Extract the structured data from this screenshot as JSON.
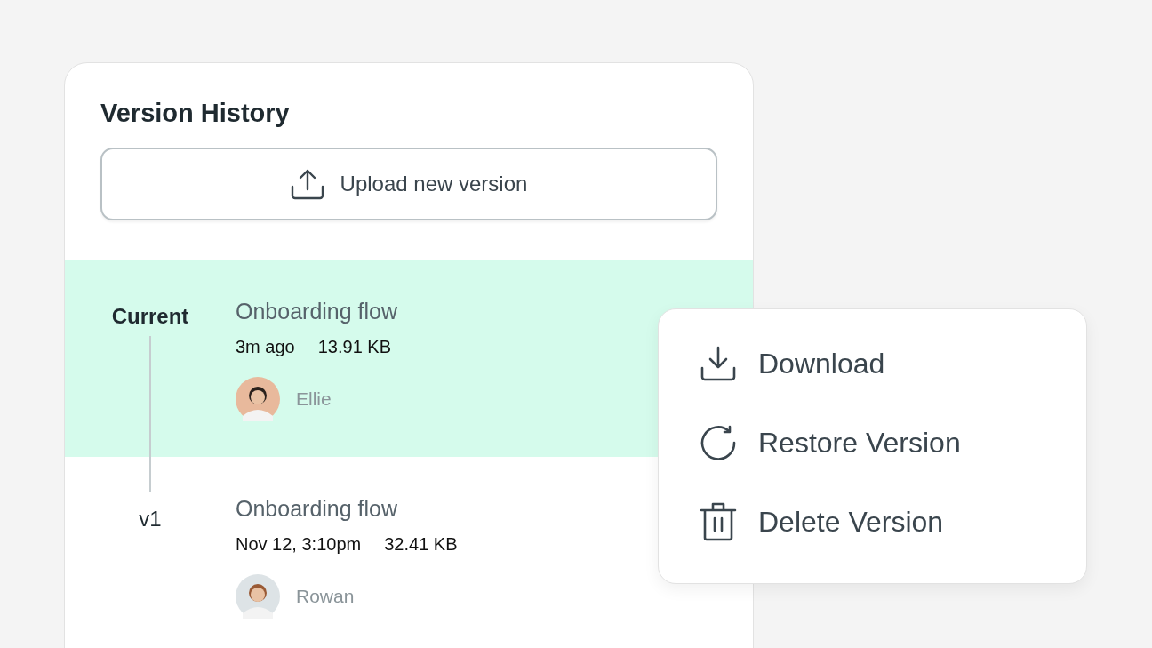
{
  "panel": {
    "title": "Version History",
    "upload_button": "Upload new version"
  },
  "versions": [
    {
      "label": "Current",
      "name": "Onboarding flow",
      "time": "3m ago",
      "size": "13.91 KB",
      "user": "Ellie",
      "selected": true
    },
    {
      "label": "v1",
      "name": "Onboarding flow",
      "time": "Nov 12, 3:10pm",
      "size": "32.41 KB",
      "user": "Rowan",
      "selected": false
    }
  ],
  "menu": [
    {
      "kind": "download",
      "label": "Download"
    },
    {
      "kind": "restore",
      "label": "Restore Version"
    },
    {
      "kind": "delete",
      "label": "Delete Version"
    }
  ]
}
